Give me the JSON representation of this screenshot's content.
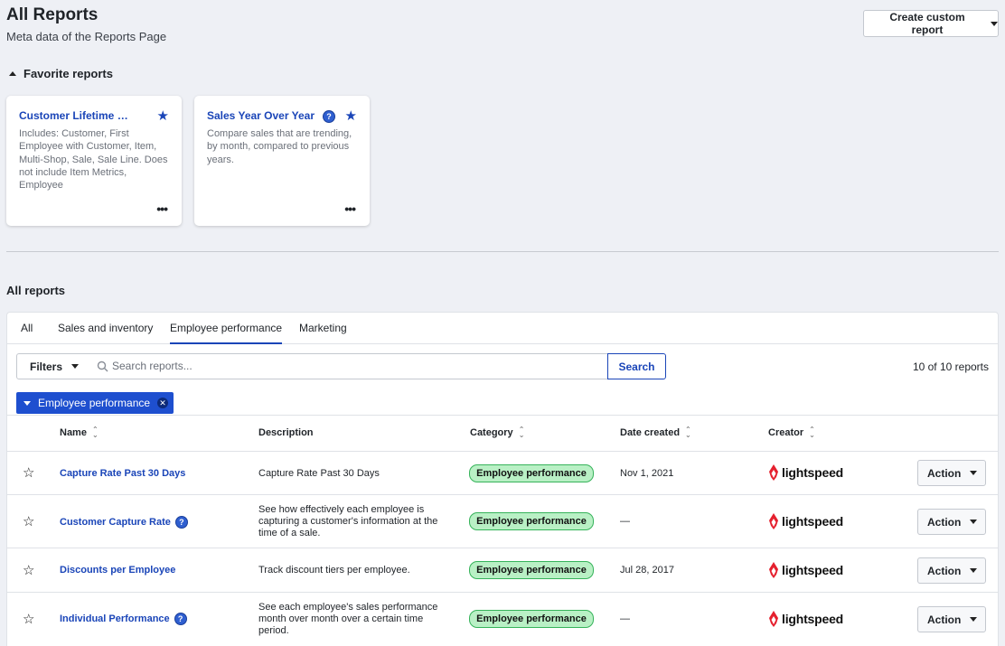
{
  "header": {
    "title": "All Reports",
    "subtitle": "Meta data of the Reports Page",
    "create_button": "Create custom report"
  },
  "favorites": {
    "heading": "Favorite reports",
    "cards": [
      {
        "title": "Customer Lifetime V...",
        "description": "Includes: Customer, First Employee with Customer, Item, Multi-Shop, Sale, Sale Line. Does not include Item Metrics, Employee",
        "help_icon": false,
        "starred": true,
        "more": "•••"
      },
      {
        "title": "Sales Year Over Year",
        "description": "Compare sales that are trending, by month, compared to previous years.",
        "help_icon": true,
        "starred": true,
        "more": "•••"
      }
    ]
  },
  "all_reports": {
    "heading": "All reports",
    "tabs": [
      {
        "label": "All",
        "active": false
      },
      {
        "label": "Sales and inventory",
        "active": false
      },
      {
        "label": "Employee performance",
        "active": true
      },
      {
        "label": "Marketing",
        "active": false
      }
    ],
    "filters_label": "Filters",
    "search_placeholder": "Search reports...",
    "search_button": "Search",
    "count": "10 of 10 reports",
    "active_filter": "Employee performance",
    "columns": {
      "name": "Name",
      "description": "Description",
      "category": "Category",
      "date_created": "Date created",
      "creator": "Creator"
    },
    "rows": [
      {
        "name": "Capture Rate Past 30 Days",
        "help": false,
        "description": "Capture Rate Past 30 Days",
        "category": "Employee performance",
        "date": "Nov 1, 2021",
        "creator": "lightspeed",
        "action": "Action"
      },
      {
        "name": "Customer Capture Rate",
        "help": true,
        "description": "See how effectively each employee is capturing a customer's information at the time of a sale.",
        "category": "Employee performance",
        "date": "—",
        "creator": "lightspeed",
        "action": "Action"
      },
      {
        "name": "Discounts per Employee",
        "help": false,
        "description": "Track discount tiers per employee.",
        "category": "Employee performance",
        "date": "Jul 28, 2017",
        "creator": "lightspeed",
        "action": "Action"
      },
      {
        "name": "Individual Performance",
        "help": true,
        "description": "See each employee's sales performance month over month over a certain time period.",
        "category": "Employee performance",
        "date": "—",
        "creator": "lightspeed",
        "action": "Action"
      }
    ]
  },
  "colors": {
    "accent": "#1a45b8",
    "chip": "#1e4fcf",
    "badge_bg": "#b9f0c5",
    "badge_border": "#36b35a",
    "logo_red": "#e5202e"
  }
}
